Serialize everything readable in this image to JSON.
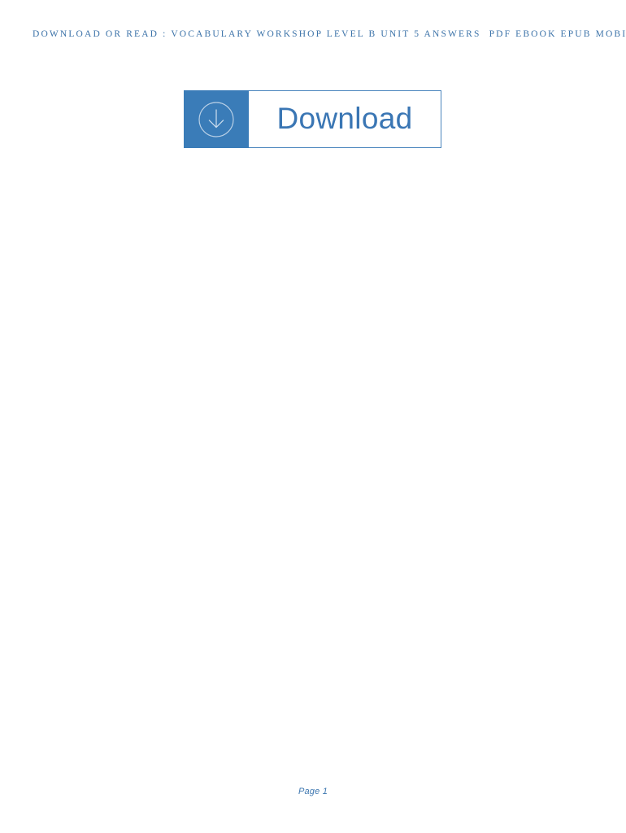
{
  "document": {
    "header_line": "DOWNLOAD OR READ : VOCABULARY WORKSHOP LEVEL B UNIT 5 ANSWERS  PDF EBOOK EPUB MOBI",
    "header_color": "#3b72a8",
    "background_color": "#ffffff"
  },
  "download_button": {
    "label": "Download",
    "icon": "download-circle-arrow-icon",
    "block_color": "#3a7cb8",
    "label_color": "#3a76b4",
    "border_color": "#4a85bd",
    "panel_color": "#ffffff"
  },
  "footer": {
    "page_label": "Page 1",
    "color": "#3e77b0"
  }
}
